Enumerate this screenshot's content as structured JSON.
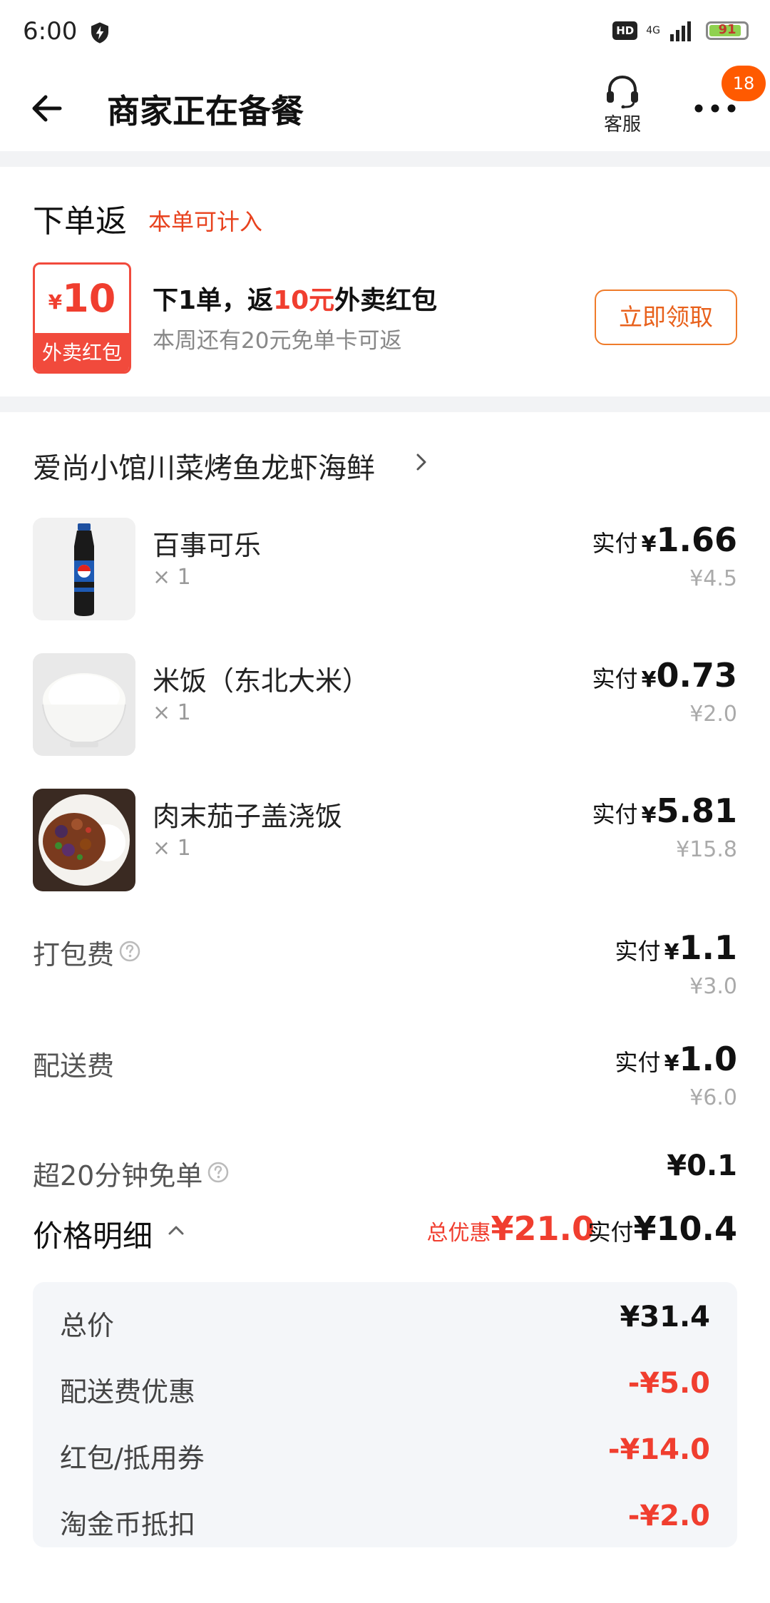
{
  "status": {
    "time": "6:00",
    "hd": "HD",
    "network": "4G",
    "battery": "91"
  },
  "nav": {
    "title": "商家正在备餐",
    "service_label": "客服",
    "badge": "18"
  },
  "promo": {
    "title": "下单返",
    "subtitle": "本单可计入",
    "coupon_yen": "¥",
    "coupon_amount": "10",
    "coupon_label": "外卖红包",
    "line1_pre": "下1单，返",
    "line1_red": "10元",
    "line1_post": "外卖红包",
    "line2": "本周还有20元免单卡可返",
    "button": "立即领取"
  },
  "shop": {
    "name": "爱尚小馆川菜烤鱼龙虾海鲜"
  },
  "items": [
    {
      "name": "百事可乐",
      "qty": "× 1",
      "paid_label": "实付",
      "yen": "¥",
      "paid": "1.66",
      "original": "¥4.5",
      "icon": "cola-bottle-image"
    },
    {
      "name": "米饭（东北大米）",
      "qty": "× 1",
      "paid_label": "实付",
      "yen": "¥",
      "paid": "0.73",
      "original": "¥2.0",
      "icon": "rice-bowl-image"
    },
    {
      "name": "肉末茄子盖浇饭",
      "qty": "× 1",
      "paid_label": "实付",
      "yen": "¥",
      "paid": "5.81",
      "original": "¥15.8",
      "icon": "eggplant-rice-image"
    }
  ],
  "fees": {
    "packing": {
      "name": "打包费",
      "paid_label": "实付",
      "yen": "¥",
      "paid": "1.1",
      "original": "¥3.0"
    },
    "delivery": {
      "name": "配送费",
      "paid_label": "实付",
      "yen": "¥",
      "paid": "1.0",
      "original": "¥6.0"
    },
    "overtime": {
      "name": "超20分钟免单",
      "value": "¥0.1"
    }
  },
  "price_detail": {
    "title": "价格明细",
    "discount_label": "总优惠",
    "discount_amount": "¥21.0",
    "paid_label": "实付",
    "paid_amount": "¥10.4"
  },
  "breakdown": [
    {
      "name": "总价",
      "value": "¥31.4"
    },
    {
      "name": "配送费优惠",
      "value": "-¥5.0"
    },
    {
      "name": "红包/抵用券",
      "value": "-¥14.0"
    },
    {
      "name": "淘金币抵扣",
      "value": "-¥2.0"
    }
  ],
  "colors": {
    "accent_red": "#f03e2f",
    "accent_orange": "#ff5a00"
  }
}
